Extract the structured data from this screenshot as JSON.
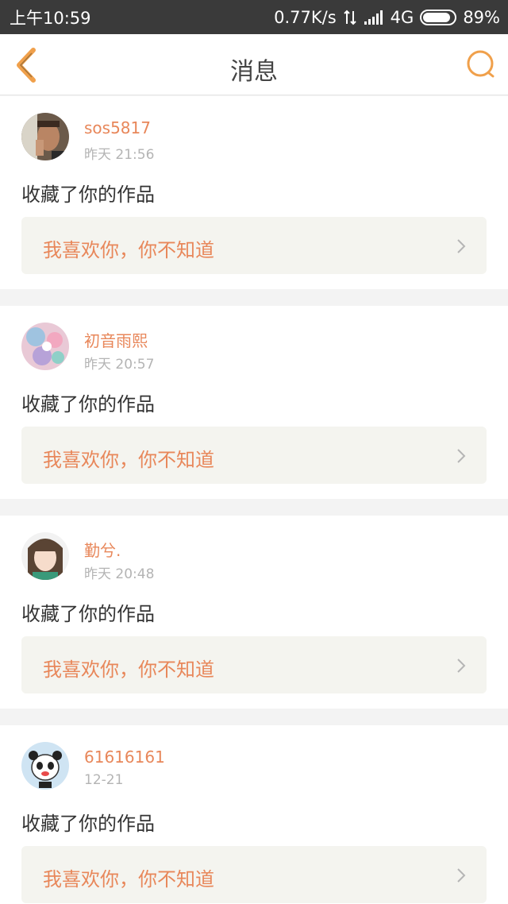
{
  "status_bar": {
    "time": "上午10:59",
    "net_speed": "0.77K/s",
    "network": "4G",
    "battery": "89%",
    "battery_level": 0.89
  },
  "header": {
    "title": "消息",
    "back_icon": "back-chevron-icon",
    "search_icon": "search-icon",
    "accent": "#f0a04b"
  },
  "messages": [
    {
      "username": "sos5817",
      "time": "昨天 21:56",
      "action": "收藏了你的作品",
      "work_title": "我喜欢你，你不知道"
    },
    {
      "username": "初音雨熙",
      "time": "昨天 20:57",
      "action": "收藏了你的作品",
      "work_title": "我喜欢你，你不知道"
    },
    {
      "username": "勤兮.",
      "time": "昨天 20:48",
      "action": "收藏了你的作品",
      "work_title": "我喜欢你，你不知道"
    },
    {
      "username": "61616161",
      "time": "12-21",
      "action": "收藏了你的作品",
      "work_title": "我喜欢你，你不知道"
    }
  ],
  "colors": {
    "username": "#e8875a",
    "work_bg": "#f4f4ef",
    "status_bar": "#3a3a3a"
  }
}
